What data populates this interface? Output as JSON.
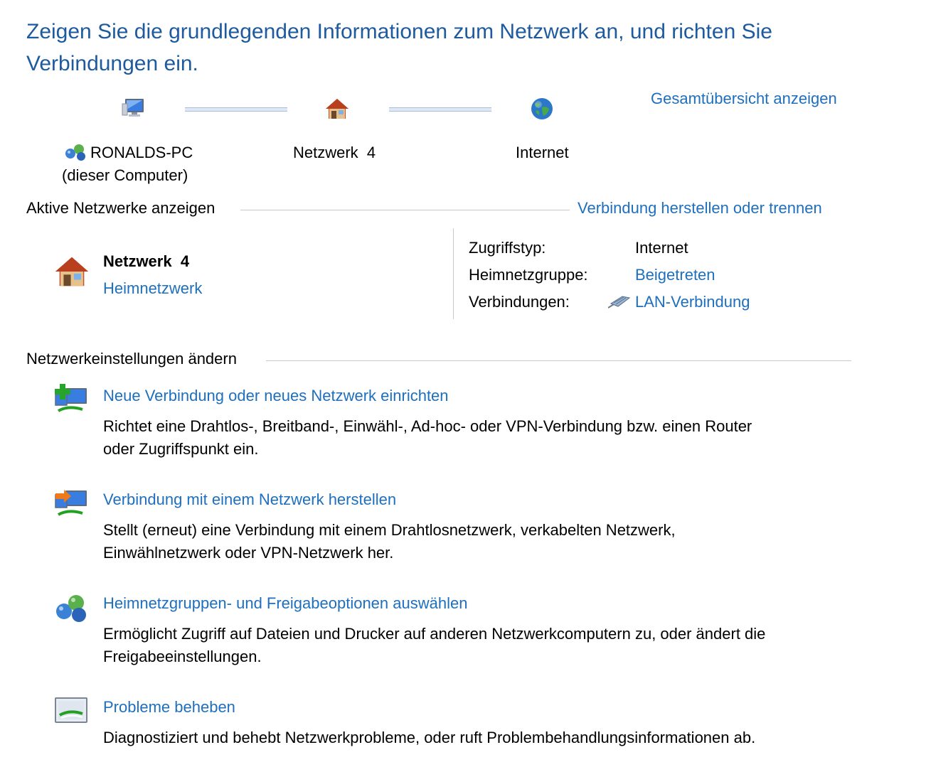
{
  "page": {
    "title": "Zeigen Sie die grundlegenden Informationen zum Netzwerk an, und richten Sie Verbindungen ein.",
    "full_map_link": "Gesamtübersicht anzeigen"
  },
  "network_map": {
    "computer_name": "RONALDS-PC",
    "computer_sub": "(dieser Computer)",
    "network_name": "Netzwerk  4",
    "internet_label": "Internet",
    "icons": [
      "computer-icon",
      "house-icon",
      "globe-icon"
    ]
  },
  "active_networks": {
    "header": "Aktive Netzwerke anzeigen",
    "connect_link": "Verbindung herstellen oder trennen",
    "network_name": "Netzwerk  4",
    "network_type": "Heimnetzwerk",
    "details": {
      "access_label": "Zugriffstyp:",
      "access_value": "Internet",
      "homegroup_label": "Heimnetzgruppe:",
      "homegroup_value": "Beigetreten",
      "connections_label": "Verbindungen:",
      "connections_value": "LAN-Verbindung"
    }
  },
  "settings": {
    "header": "Netzwerkeinstellungen ändern",
    "tasks": [
      {
        "title": "Neue Verbindung oder neues Netzwerk einrichten",
        "line1": "Richtet eine Drahtlos-, Breitband-, Einwähl-, Ad-hoc- oder VPN-Verbindung bzw. einen Router",
        "line2": "oder Zugriffspunkt ein.",
        "icon": "new-connection-icon"
      },
      {
        "title": "Verbindung mit einem Netzwerk herstellen",
        "line1": "Stellt (erneut) eine Verbindung mit einem Drahtlosnetzwerk, verkabelten Netzwerk,",
        "line2": "Einwählnetzwerk oder VPN-Netzwerk her.",
        "icon": "connect-network-icon"
      },
      {
        "title": "Heimnetzgruppen- und Freigabeoptionen auswählen",
        "line1": "Ermöglicht Zugriff auf Dateien und Drucker auf anderen Netzwerkcomputern zu, oder ändert die",
        "line2": "Freigabeeinstellungen.",
        "icon": "homegroup-icon"
      },
      {
        "title": "Probleme beheben",
        "line1": "Diagnostiziert und behebt Netzwerkprobleme, oder ruft Problembehandlungsinformationen ab.",
        "icon": "troubleshoot-icon"
      }
    ]
  },
  "colors": {
    "link": "#1e6fbd",
    "title": "#1e5a9e",
    "separator": "#c9c9c9"
  }
}
